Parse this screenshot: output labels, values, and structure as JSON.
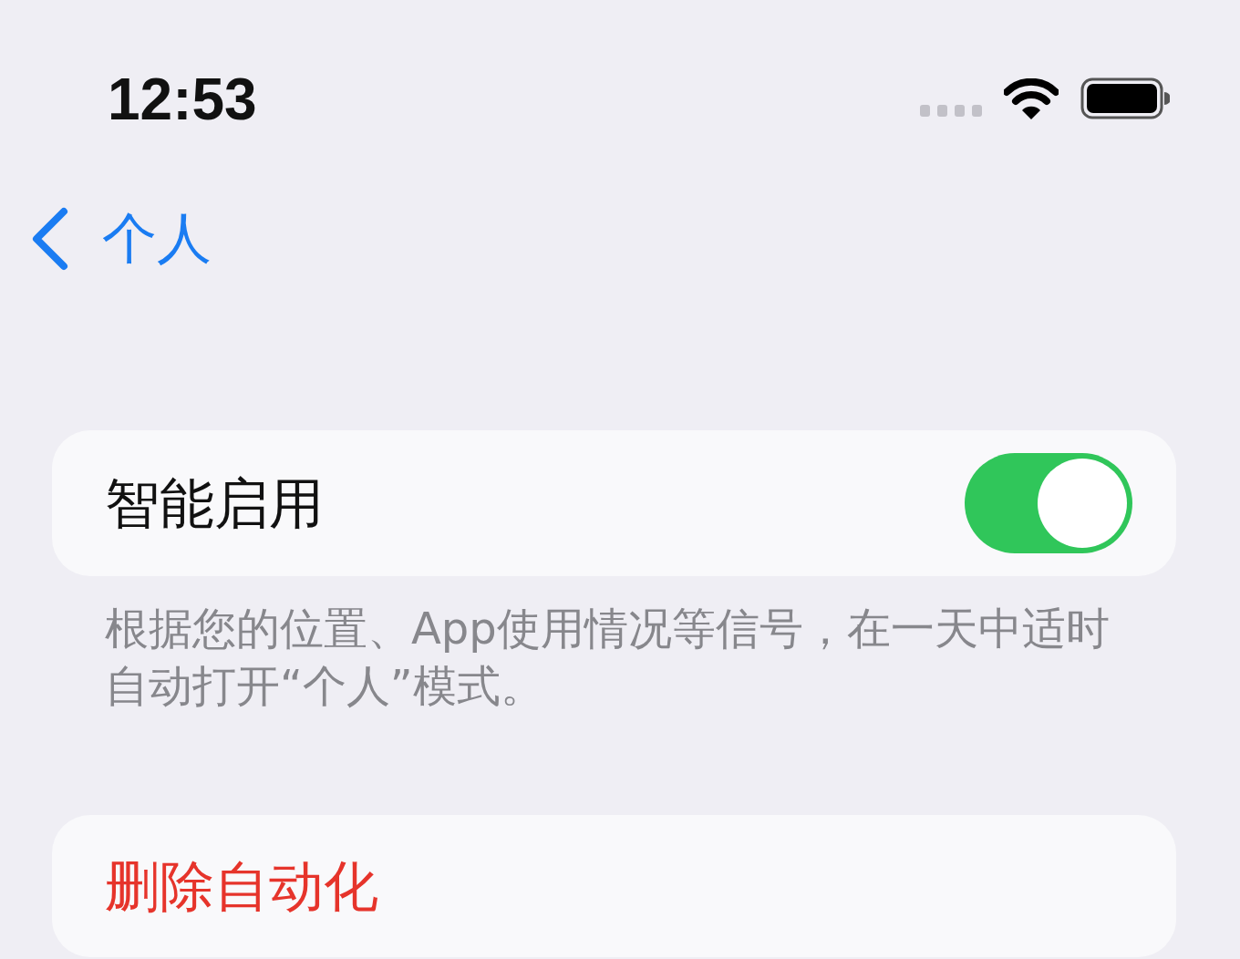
{
  "status_bar": {
    "time": "12:53"
  },
  "nav": {
    "back_label": "个人"
  },
  "settings": [
    {
      "kind": "toggle",
      "label": "智能启用",
      "on": true
    }
  ],
  "footer_note": "根据您的位置、App使用情况等信号，在一天中适时自动打开“个人”模式。",
  "actions": [
    {
      "kind": "destructive",
      "label": "删除自动化"
    }
  ]
}
